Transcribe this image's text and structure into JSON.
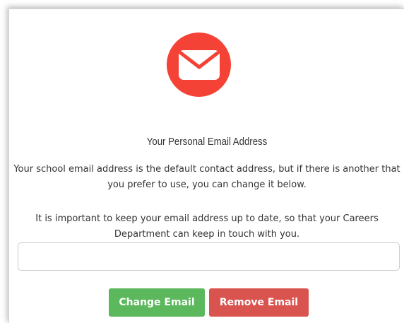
{
  "header": {
    "icon": "envelope-icon",
    "title": "Your Personal Email Address"
  },
  "body": {
    "paragraph_1": "Your school email address is the default contact address, but if there is another that you prefer to use, you can change it below.",
    "paragraph_2": "It is important to keep your email address up to date, so that your Careers Department can keep in touch with you."
  },
  "form": {
    "email_value": "",
    "email_placeholder": ""
  },
  "actions": {
    "change_label": "Change Email",
    "remove_label": "Remove Email"
  },
  "colors": {
    "icon_circle": "#f44336",
    "change_button": "#5cb85c",
    "remove_button": "#d9534f",
    "text": "#333333"
  }
}
